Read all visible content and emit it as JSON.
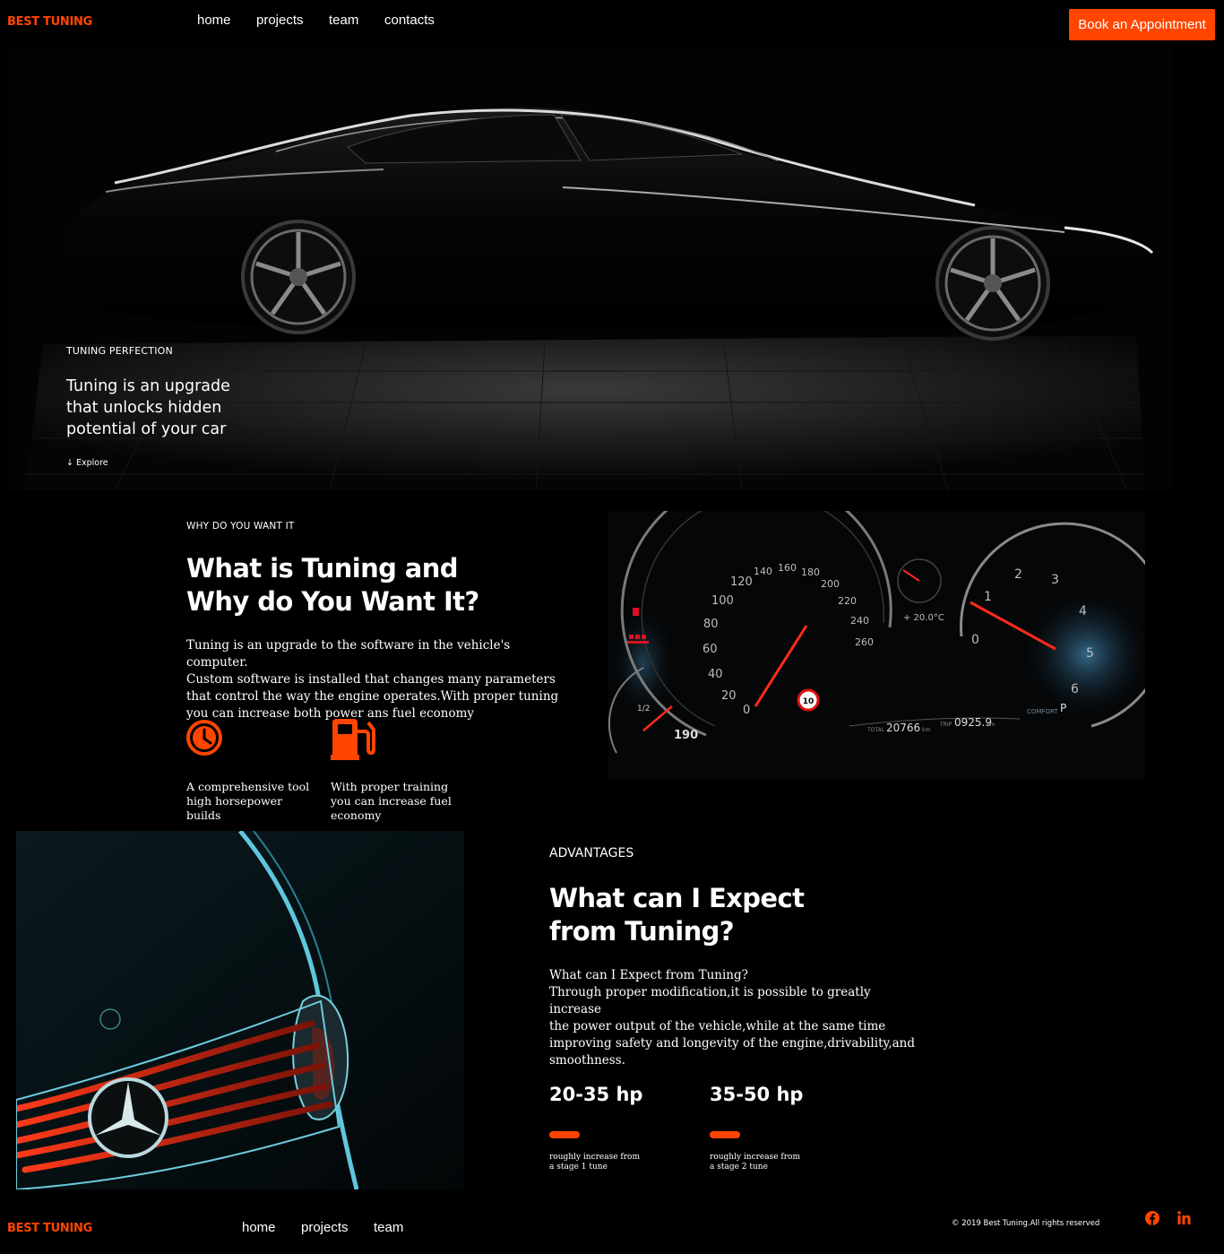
{
  "header": {
    "brand": "BEST TUNING",
    "nav": [
      "home",
      "projects",
      "team",
      "contacts"
    ],
    "cta": "Book an Appointment"
  },
  "hero": {
    "kicker": "TUNING PERFECTION",
    "headline": [
      "Tuning is an upgrade",
      "that unlocks hidden",
      "potential of your car"
    ],
    "explore": "Explore"
  },
  "why": {
    "kicker": "WHY DO YOU WANT IT",
    "title": [
      "What is Tuning and",
      "Why do You Want It?"
    ],
    "body": [
      "Tuning is an upgrade to the software in the vehicle's computer.",
      "Custom software is installed that changes many parameters",
      "that control the way the engine operates.With proper tuning",
      "you can increase both power ans fuel economy"
    ],
    "features": [
      {
        "icon": "clock-icon",
        "text": [
          "A comprehensive tool",
          "high horsepower",
          "builds"
        ]
      },
      {
        "icon": "fuel-pump-icon",
        "text": [
          "With proper training",
          "you can increase fuel",
          "economy"
        ]
      }
    ]
  },
  "dash": {
    "speed_ticks": [
      "0",
      "20",
      "40",
      "60",
      "80",
      "100",
      "120",
      "140",
      "160",
      "180",
      "200",
      "220",
      "240",
      "260"
    ],
    "rpm_ticks": [
      "0",
      "1",
      "2",
      "3",
      "4",
      "5",
      "6"
    ],
    "speed_limit": "10",
    "odo": "20766",
    "odo_unit": "km",
    "trip": "0925.9",
    "trip_unit": "km",
    "temp": "+ 20.0°C",
    "range": "190",
    "fuel_frac": "1/2",
    "mode": "COMFORT",
    "gear": "P",
    "total_label": "TOTAL",
    "trip_label": "TRIP"
  },
  "adv": {
    "kicker": "ADVANTAGES",
    "title": [
      "What can I Expect",
      "from Tuning?"
    ],
    "body": [
      "What can I Expect from Tuning?",
      "Through proper modification,it is possible to greatly increase",
      "the power output of the vehicle,while at the same time",
      "improving safety and longevity of the engine,drivability,and",
      "smoothness."
    ],
    "stats": [
      {
        "value": "20-35 hp",
        "caption": [
          "roughly increase from",
          "a stage 1 tune"
        ]
      },
      {
        "value": "35-50 hp",
        "caption": [
          "roughly increase from",
          "a stage 2 tune"
        ]
      }
    ]
  },
  "footer": {
    "brand": "BEST TUNING",
    "nav": [
      "home",
      "projects",
      "team"
    ],
    "copyright": "© 2019 Best Tuning.All rights reserved",
    "social": [
      "facebook-icon",
      "linkedin-icon"
    ]
  },
  "colors": {
    "accent": "#ff4500",
    "background": "#000000"
  }
}
